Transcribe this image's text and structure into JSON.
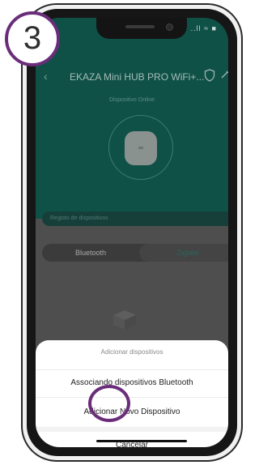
{
  "step": {
    "number": "3"
  },
  "status": {
    "icons": "..ll ≈ ■"
  },
  "header": {
    "title": "EKAZA Mini HUB PRO WiFi+...",
    "online_text": "Dispositivo Online"
  },
  "registry": {
    "label": "Registo de dispositivos",
    "chevron": "›"
  },
  "tabs": [
    {
      "label": "Bluetooth",
      "selected": false
    },
    {
      "label": "Zigbee",
      "selected": true
    }
  ],
  "sheet": {
    "title": "Adicionar dispositivos",
    "options": [
      "Associando dispositivos Bluetooth",
      "Adicionar Novo Dispositivo"
    ],
    "cancel_label": "Cancelar"
  },
  "colors": {
    "header_bg": "#0f5147",
    "accent": "#1e6b5c",
    "highlight": "#6a2d7a"
  }
}
